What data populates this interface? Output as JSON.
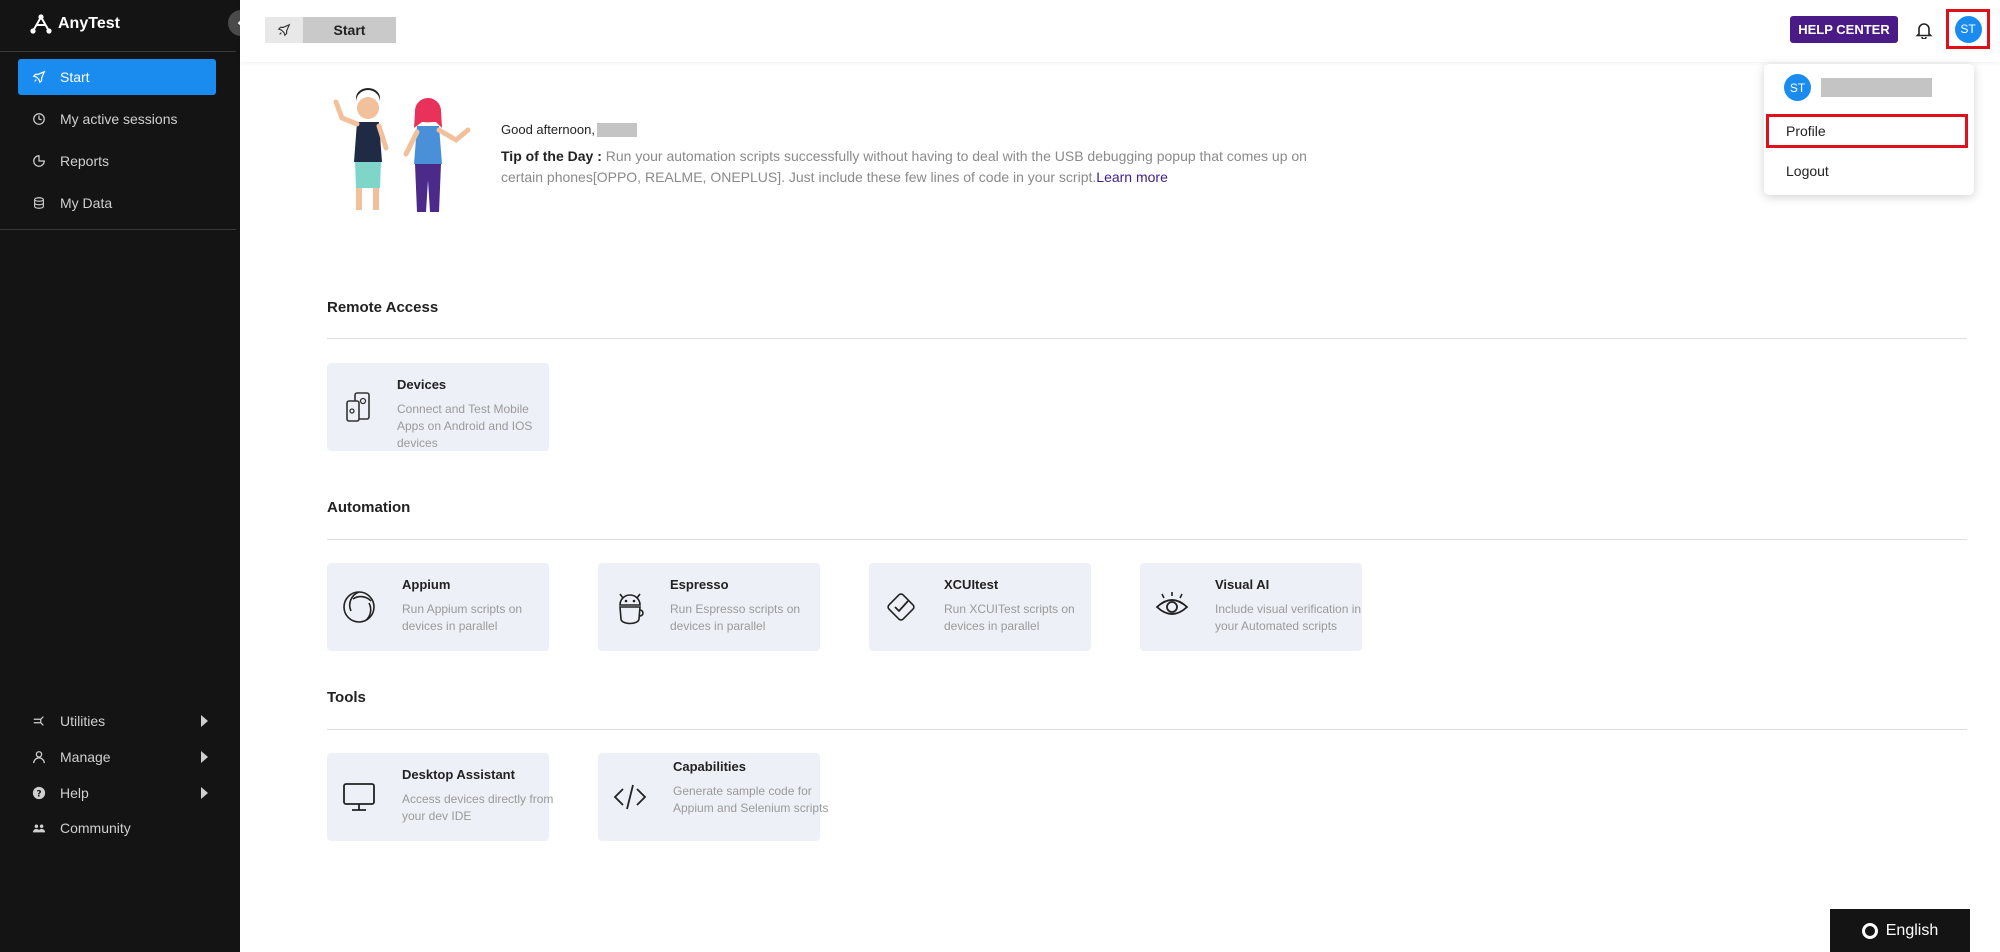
{
  "app": {
    "logo_text": "AnyTest"
  },
  "sidebar": {
    "items": [
      {
        "label": "Start",
        "icon": "rocket-icon"
      },
      {
        "label": "My active sessions",
        "icon": "clock-icon"
      },
      {
        "label": "Reports",
        "icon": "chart-icon"
      },
      {
        "label": "My Data",
        "icon": "database-icon"
      }
    ],
    "bottom_items": [
      {
        "label": "Utilities",
        "icon": "utilities-icon"
      },
      {
        "label": "Manage",
        "icon": "person-icon"
      },
      {
        "label": "Help",
        "icon": "question-icon"
      },
      {
        "label": "Community",
        "icon": "people-icon"
      }
    ]
  },
  "topbar": {
    "breadcrumb": "Start",
    "help_center": "HELP CENTER",
    "avatar_initials": "ST"
  },
  "dropdown": {
    "avatar_initials": "ST",
    "items": [
      {
        "label": "Profile"
      },
      {
        "label": "Logout"
      }
    ]
  },
  "greeting": {
    "text": "Good afternoon,",
    "tip_label": "Tip of the Day :",
    "tip_text": " Run your automation scripts successfully without having to deal with the USB debugging popup that comes up on certain phones[OPPO, REALME, ONEPLUS]. Just include these few lines of code in your script.",
    "learn_more": "Learn more"
  },
  "sections": {
    "remote_access": {
      "title": "Remote Access",
      "cards": [
        {
          "title": "Devices",
          "desc": "Connect and Test Mobile Apps on Android and IOS devices"
        }
      ]
    },
    "automation": {
      "title": "Automation",
      "cards": [
        {
          "title": "Appium",
          "desc": "Run Appium scripts on devices in parallel"
        },
        {
          "title": "Espresso",
          "desc": "Run Espresso scripts on devices in parallel"
        },
        {
          "title": "XCUItest",
          "desc": "Run XCUITest scripts on devices in parallel"
        },
        {
          "title": "Visual AI",
          "desc": "Include visual verification in your Automated scripts"
        }
      ]
    },
    "tools": {
      "title": "Tools",
      "cards": [
        {
          "title": "Desktop Assistant",
          "desc": "Access devices directly from your dev IDE"
        },
        {
          "title": "Capabilities",
          "desc": "Generate sample code for Appium and Selenium scripts"
        }
      ]
    }
  },
  "language": {
    "label": "English"
  },
  "colors": {
    "sidebar_bg": "#141414",
    "accent_blue": "#1a8cf0",
    "help_purple": "#4a1a86",
    "highlight_red": "#e0101a",
    "card_bg": "#eef0f7"
  }
}
